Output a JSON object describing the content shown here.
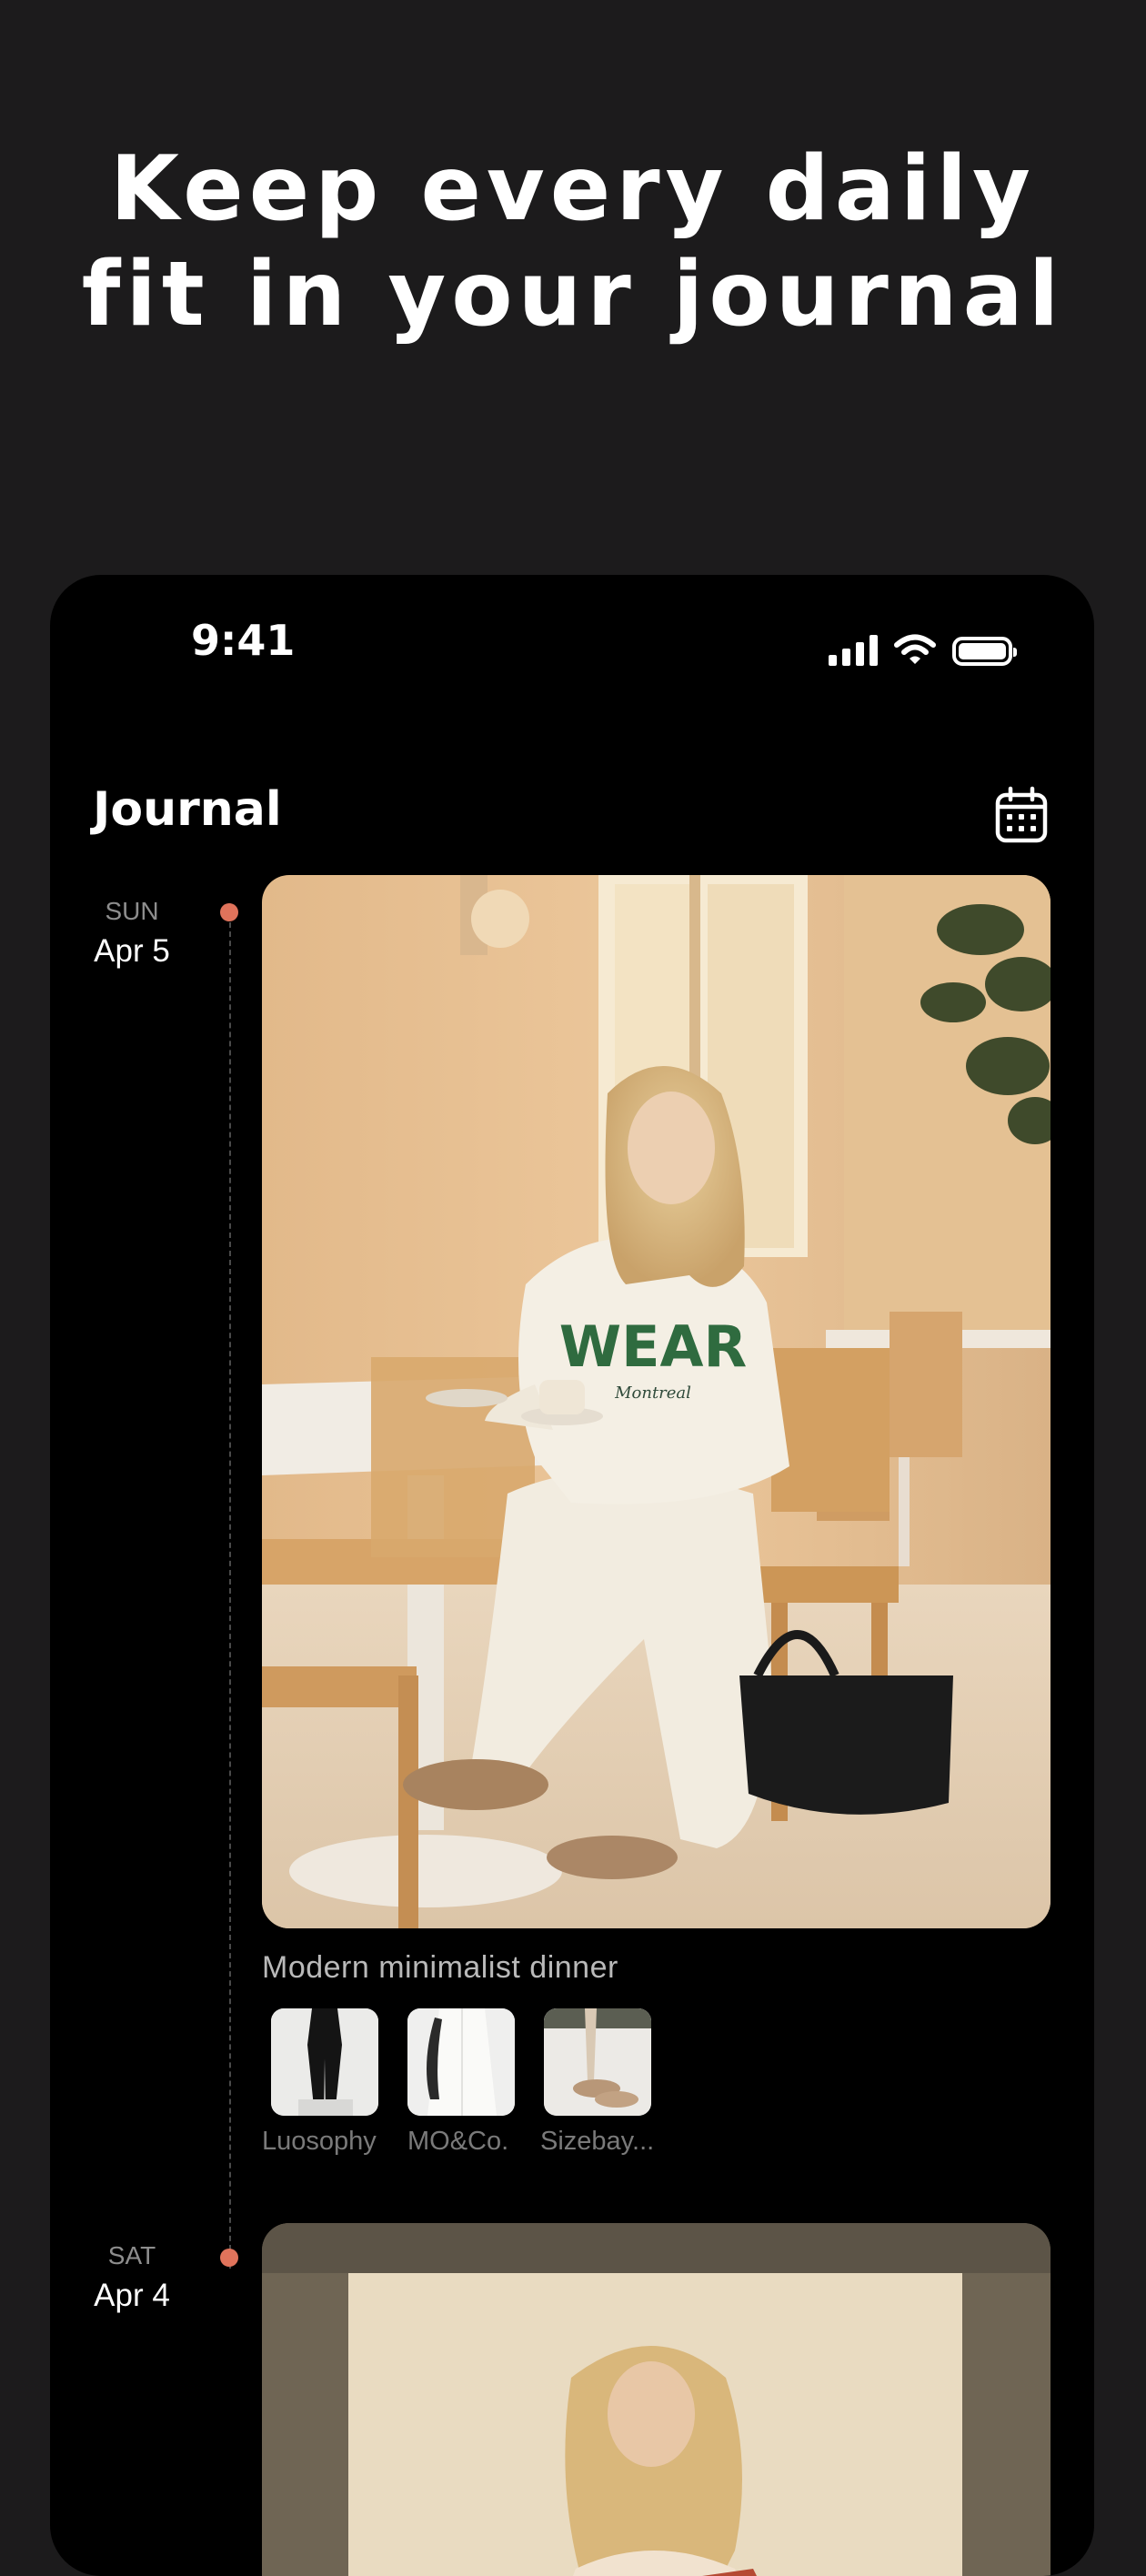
{
  "headline": {
    "line1": "Keep every daily",
    "line2": "fit in your journal"
  },
  "status_bar": {
    "time": "9:41",
    "icons": [
      "cellular-signal-icon",
      "wifi-icon",
      "battery-icon"
    ]
  },
  "header": {
    "title": "Journal",
    "calendar_icon": "calendar-icon"
  },
  "colors": {
    "background": "#1c1b1c",
    "phone": "#000000",
    "accent_dot": "#e0735b"
  },
  "entries": [
    {
      "day": "SUN",
      "date": "Apr 5",
      "caption": "Modern minimalist dinner",
      "items": [
        {
          "brand": "Luosophy"
        },
        {
          "brand": "MO&Co."
        },
        {
          "brand": "Sizebay..."
        }
      ]
    },
    {
      "day": "SAT",
      "date": "Apr 4"
    }
  ],
  "photo_text": {
    "sweatshirt": "WEAR",
    "sweatshirt_script": "Montreal"
  }
}
